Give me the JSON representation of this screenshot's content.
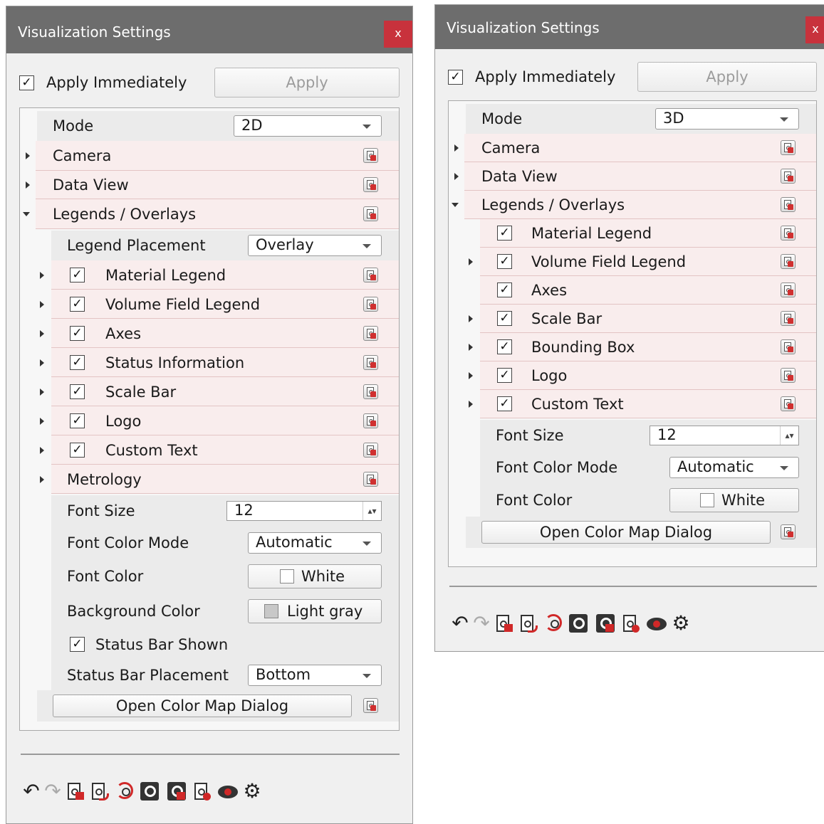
{
  "panels": [
    {
      "title": "Visualization Settings",
      "close_label": "x",
      "apply_immediately": {
        "label": "Apply Immediately",
        "checked": true
      },
      "apply_button": "Apply",
      "mode": {
        "label": "Mode",
        "value": "2D"
      },
      "sections": [
        {
          "label": "Camera",
          "expanded": false
        },
        {
          "label": "Data View",
          "expanded": false
        },
        {
          "label": "Legends / Overlays",
          "expanded": true
        }
      ],
      "legend_placement": {
        "label": "Legend Placement",
        "value": "Overlay"
      },
      "overlay_items": [
        {
          "label": "Material Legend",
          "checked": true,
          "expandable": true
        },
        {
          "label": "Volume Field Legend",
          "checked": true,
          "expandable": true
        },
        {
          "label": "Axes",
          "checked": true,
          "expandable": true
        },
        {
          "label": "Status Information",
          "checked": true,
          "expandable": true
        },
        {
          "label": "Scale Bar",
          "checked": true,
          "expandable": true
        },
        {
          "label": "Logo",
          "checked": true,
          "expandable": true
        },
        {
          "label": "Custom Text",
          "checked": true,
          "expandable": true
        },
        {
          "label": "Metrology",
          "checked": false,
          "has_checkbox": false,
          "expandable": true
        }
      ],
      "font_size": {
        "label": "Font Size",
        "value": "12"
      },
      "font_color_mode": {
        "label": "Font Color Mode",
        "value": "Automatic"
      },
      "font_color": {
        "label": "Font Color",
        "value": "White",
        "swatch": "#ffffff"
      },
      "background_color": {
        "label": "Background Color",
        "value": "Light gray",
        "swatch": "#c8c8c8"
      },
      "status_bar_shown": {
        "label": "Status Bar Shown",
        "checked": true
      },
      "status_bar_placement": {
        "label": "Status Bar Placement",
        "value": "Bottom"
      },
      "color_map_button": "Open Color Map Dialog"
    },
    {
      "title": "Visualization Settings",
      "close_label": "x",
      "apply_immediately": {
        "label": "Apply Immediately",
        "checked": true
      },
      "apply_button": "Apply",
      "mode": {
        "label": "Mode",
        "value": "3D"
      },
      "sections": [
        {
          "label": "Camera",
          "expanded": false
        },
        {
          "label": "Data View",
          "expanded": false
        },
        {
          "label": "Legends / Overlays",
          "expanded": true
        }
      ],
      "overlay_items": [
        {
          "label": "Material Legend",
          "checked": true,
          "expandable": false
        },
        {
          "label": "Volume Field Legend",
          "checked": true,
          "expandable": true
        },
        {
          "label": "Axes",
          "checked": true,
          "expandable": false
        },
        {
          "label": "Scale Bar",
          "checked": true,
          "expandable": true
        },
        {
          "label": "Bounding Box",
          "checked": true,
          "expandable": true
        },
        {
          "label": "Logo",
          "checked": true,
          "expandable": true
        },
        {
          "label": "Custom Text",
          "checked": true,
          "expandable": true
        }
      ],
      "font_size": {
        "label": "Font Size",
        "value": "12"
      },
      "font_color_mode": {
        "label": "Font Color Mode",
        "value": "Automatic"
      },
      "font_color": {
        "label": "Font Color",
        "value": "White",
        "swatch": "#ffffff"
      },
      "color_map_button": "Open Color Map Dialog"
    }
  ],
  "checkmark": "✓",
  "toolbar_icons": [
    "undo-icon",
    "redo-icon",
    "lock-settings-icon",
    "export-settings-icon",
    "reset-settings-icon",
    "load-settings-icon",
    "save-settings-icon",
    "script-icon",
    "visibility-icon",
    "gear-icon"
  ],
  "toolbar_glyphs": {
    "undo": "↶",
    "redo": "↷",
    "gear": "⚙",
    "spin": "⇅"
  },
  "colors": {
    "titlebar": "#6d6d6d",
    "close": "#c8323c",
    "row_tint": "#f9eded",
    "accent_red": "#d02828"
  }
}
